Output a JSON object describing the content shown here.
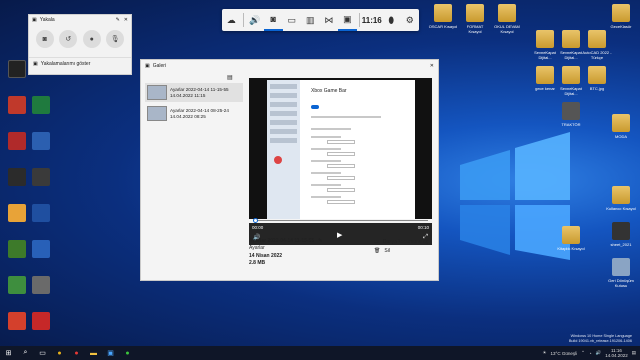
{
  "gamebar": {
    "time": "11:16"
  },
  "capture": {
    "title": "Yakala",
    "show_captures": "Yakalamalarımı göster"
  },
  "gallery": {
    "title": "Galeri",
    "items": [
      {
        "name": "Ayarlar 2022-04-14 11-15-55",
        "date": "14.04.2022 11:15"
      },
      {
        "name": "Ayarlar 2022-04-14 08-25-24",
        "date": "14.04.2022 08:25"
      }
    ],
    "viewer": {
      "app_title": "Xbox Game Bar",
      "time_left": "00:00",
      "time_right": "00:10"
    },
    "info": {
      "file_name": "Ayarlar 2022-04-14 11-15-55",
      "app": "Ayarlar",
      "date": "14 Nisan 2022",
      "size": "2.8 MB"
    },
    "actions": {
      "open_location": "Dosya konumunu aç",
      "delete": "Sil"
    }
  },
  "desktop": {
    "left_labels": [
      "",
      "",
      "",
      "",
      "",
      "",
      "",
      ""
    ],
    "top_right_labels": [
      "OSCAR Kısayol",
      "FORMAT Kısayol",
      "OKUL DEVAM Kısayol"
    ],
    "right_labels": [
      "GeceKlasör",
      "SevneKapat Dijital...",
      "SevneKapat Dijital...",
      "AutoCAD 2022 - Türkçe",
      "SevneKapat Dijital...",
      "BTC.jpg",
      "gece kenar",
      "TRAKTÖR",
      "MODA",
      "Kitaplık Kısayol",
      "Kullanıcı Kısayol",
      "Yeni klasör",
      "sheet_2021",
      "Geri Dönüşüm Kutusu"
    ]
  },
  "watermark": {
    "line1": "Windows 10 Home Single Language",
    "line2": "Build 19041.vb_release.191206-1406"
  },
  "taskbar": {
    "weather": "13°C  Güneşli",
    "clock_time": "11:16",
    "clock_date": "14.04.2022"
  },
  "colors": {
    "accent": "#0a64d2",
    "taskbar": "#0f1628"
  }
}
